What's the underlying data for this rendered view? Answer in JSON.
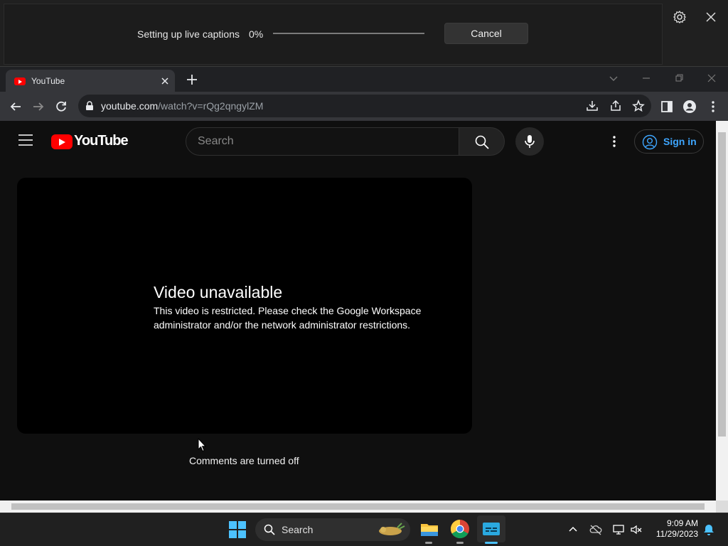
{
  "live_captions": {
    "status": "Setting up live captions",
    "progress_text": "0%",
    "progress": 0,
    "cancel_label": "Cancel"
  },
  "browser": {
    "tab_title": "YouTube",
    "url_domain": "youtube.com",
    "url_path": "/watch?v=rQg2qngylZM"
  },
  "youtube": {
    "wordmark": "YouTube",
    "search_placeholder": "Search",
    "sign_in_label": "Sign in",
    "error_title": "Video unavailable",
    "error_message": "This video is restricted. Please check the Google Workspace administrator and/or the network administrator restrictions.",
    "comments_status": "Comments are turned off"
  },
  "taskbar": {
    "search_label": "Search",
    "time": "9:09 AM",
    "date": "11/29/2023"
  },
  "colors": {
    "youtube_red": "#ff0000",
    "link_blue": "#3ea6ff",
    "page_bg": "#0f0f0f",
    "chrome_dark": "#35363a"
  }
}
